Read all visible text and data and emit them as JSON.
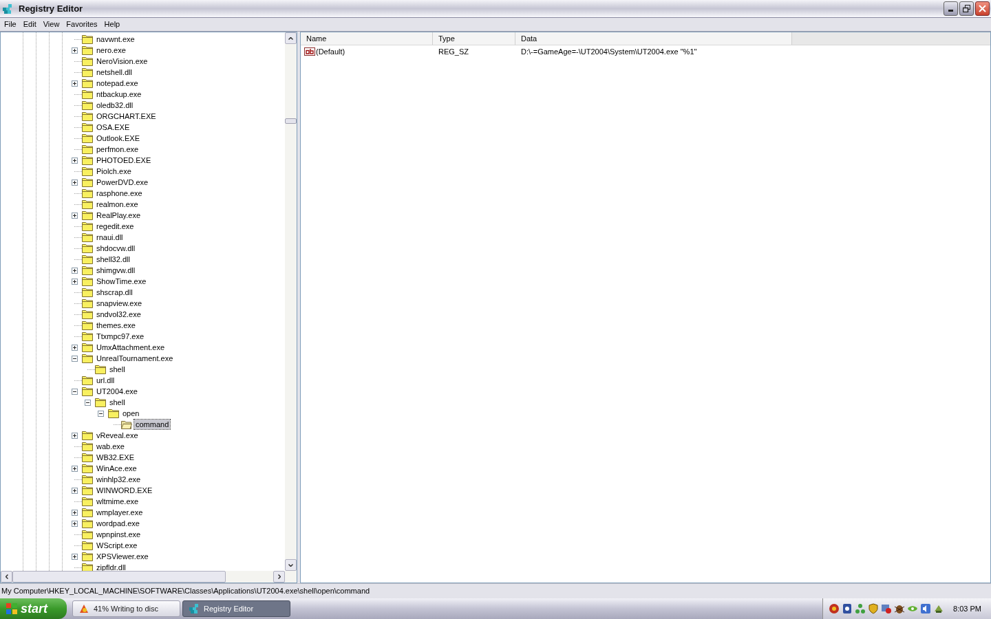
{
  "window": {
    "title": "Registry Editor"
  },
  "menu": [
    "File",
    "Edit",
    "View",
    "Favorites",
    "Help"
  ],
  "tree": [
    {
      "label": "navwnt.exe",
      "kind": "leaf",
      "selected": false
    },
    {
      "label": "nero.exe",
      "kind": "collapsed",
      "selected": false
    },
    {
      "label": "NeroVision.exe",
      "kind": "leaf",
      "selected": false
    },
    {
      "label": "netshell.dll",
      "kind": "leaf",
      "selected": false
    },
    {
      "label": "notepad.exe",
      "kind": "collapsed",
      "selected": false
    },
    {
      "label": "ntbackup.exe",
      "kind": "leaf",
      "selected": false
    },
    {
      "label": "oledb32.dll",
      "kind": "leaf",
      "selected": false
    },
    {
      "label": "ORGCHART.EXE",
      "kind": "leaf",
      "selected": false
    },
    {
      "label": "OSA.EXE",
      "kind": "leaf",
      "selected": false
    },
    {
      "label": "Outlook.EXE",
      "kind": "leaf",
      "selected": false
    },
    {
      "label": "perfmon.exe",
      "kind": "leaf",
      "selected": false
    },
    {
      "label": "PHOTOED.EXE",
      "kind": "collapsed",
      "selected": false
    },
    {
      "label": "Piolch.exe",
      "kind": "leaf",
      "selected": false
    },
    {
      "label": "PowerDVD.exe",
      "kind": "collapsed",
      "selected": false
    },
    {
      "label": "rasphone.exe",
      "kind": "leaf",
      "selected": false
    },
    {
      "label": "realmon.exe",
      "kind": "leaf",
      "selected": false
    },
    {
      "label": "RealPlay.exe",
      "kind": "collapsed",
      "selected": false
    },
    {
      "label": "regedit.exe",
      "kind": "leaf",
      "selected": false
    },
    {
      "label": "rnaui.dll",
      "kind": "leaf",
      "selected": false
    },
    {
      "label": "shdocvw.dll",
      "kind": "leaf",
      "selected": false
    },
    {
      "label": "shell32.dll",
      "kind": "leaf",
      "selected": false
    },
    {
      "label": "shimgvw.dll",
      "kind": "collapsed",
      "selected": false
    },
    {
      "label": "ShowTime.exe",
      "kind": "collapsed",
      "selected": false
    },
    {
      "label": "shscrap.dll",
      "kind": "leaf",
      "selected": false
    },
    {
      "label": "snapview.exe",
      "kind": "leaf",
      "selected": false
    },
    {
      "label": "sndvol32.exe",
      "kind": "leaf",
      "selected": false
    },
    {
      "label": "themes.exe",
      "kind": "leaf",
      "selected": false
    },
    {
      "label": "Ttxmpc97.exe",
      "kind": "leaf",
      "selected": false
    },
    {
      "label": "UmxAttachment.exe",
      "kind": "collapsed",
      "selected": false
    },
    {
      "label": "UnrealTournament.exe",
      "kind": "expanded",
      "selected": false,
      "children": [
        {
          "label": "shell",
          "kind": "leaf",
          "selected": false
        }
      ]
    },
    {
      "label": "url.dll",
      "kind": "leaf",
      "selected": false
    },
    {
      "label": "UT2004.exe",
      "kind": "expanded",
      "selected": false,
      "children": [
        {
          "label": "shell",
          "kind": "expanded",
          "selected": false,
          "children": [
            {
              "label": "open",
              "kind": "expanded",
              "selected": false,
              "children": [
                {
                  "label": "command",
                  "kind": "leaf",
                  "selected": true
                }
              ]
            }
          ]
        }
      ]
    },
    {
      "label": "vReveal.exe",
      "kind": "collapsed",
      "selected": false
    },
    {
      "label": "wab.exe",
      "kind": "leaf",
      "selected": false
    },
    {
      "label": "WB32.EXE",
      "kind": "leaf",
      "selected": false
    },
    {
      "label": "WinAce.exe",
      "kind": "collapsed",
      "selected": false
    },
    {
      "label": "winhlp32.exe",
      "kind": "leaf",
      "selected": false
    },
    {
      "label": "WINWORD.EXE",
      "kind": "collapsed",
      "selected": false
    },
    {
      "label": "wltmime.exe",
      "kind": "leaf",
      "selected": false
    },
    {
      "label": "wmplayer.exe",
      "kind": "collapsed",
      "selected": false
    },
    {
      "label": "wordpad.exe",
      "kind": "collapsed",
      "selected": false
    },
    {
      "label": "wpnpinst.exe",
      "kind": "leaf",
      "selected": false
    },
    {
      "label": "WScript.exe",
      "kind": "leaf",
      "selected": false
    },
    {
      "label": "XPSViewer.exe",
      "kind": "collapsed",
      "selected": false
    },
    {
      "label": "zipfldr.dll",
      "kind": "leaf",
      "selected": false
    }
  ],
  "values": {
    "columns": [
      "Name",
      "Type",
      "Data"
    ],
    "rows": [
      {
        "name": "(Default)",
        "type": "REG_SZ",
        "data": "D:\\-=GameAge=-\\UT2004\\System\\UT2004.exe \"%1\""
      }
    ]
  },
  "status_bar": "My Computer\\HKEY_LOCAL_MACHINE\\SOFTWARE\\Classes\\Applications\\UT2004.exe\\shell\\open\\command",
  "taskbar": {
    "start": "start",
    "tasks": [
      {
        "label": "41% Writing to disc",
        "selected": false
      },
      {
        "label": "Registry Editor",
        "selected": true
      }
    ],
    "clock": "8:03 PM"
  }
}
